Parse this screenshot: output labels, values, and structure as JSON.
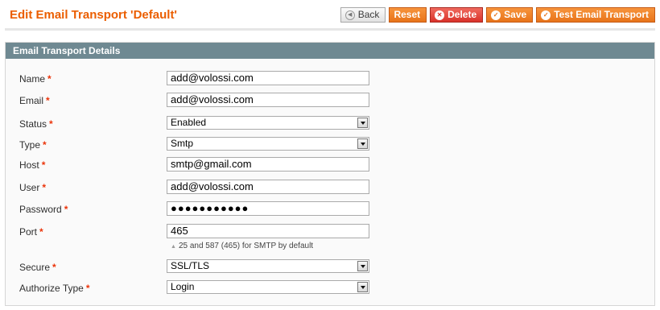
{
  "header": {
    "title": "Edit Email Transport 'Default'",
    "buttons": {
      "back": "Back",
      "reset": "Reset",
      "delete": "Delete",
      "save": "Save",
      "test": "Test Email Transport"
    }
  },
  "fieldset": {
    "legend": "Email Transport Details",
    "fields": {
      "name": {
        "label": "Name",
        "value": "add@volossi.com"
      },
      "email": {
        "label": "Email",
        "value": "add@volossi.com"
      },
      "status": {
        "label": "Status",
        "value": "Enabled"
      },
      "type": {
        "label": "Type",
        "value": "Smtp"
      },
      "host": {
        "label": "Host",
        "value": "smtp@gmail.com"
      },
      "user": {
        "label": "User",
        "value": "add@volossi.com"
      },
      "password": {
        "label": "Password",
        "value": "●●●●●●●●●●●"
      },
      "port": {
        "label": "Port",
        "value": "465",
        "note": "25 and 587 (465) for SMTP by default"
      },
      "secure": {
        "label": "Secure",
        "value": "SSL/TLS"
      },
      "authorize": {
        "label": "Authorize Type",
        "value": "Login"
      }
    },
    "required_marker": "*"
  },
  "icons": {
    "back": "circle-left-arrow-icon",
    "delete": "circle-x-icon",
    "save": "circle-check-icon",
    "test": "circle-check-icon",
    "select_arrow": "chevron-down-icon"
  },
  "colors": {
    "title": "#eb5e00",
    "primary_button": "#e8741a",
    "delete_button": "#d9322a",
    "section_header": "#6f8992",
    "required": "#eb340a"
  }
}
